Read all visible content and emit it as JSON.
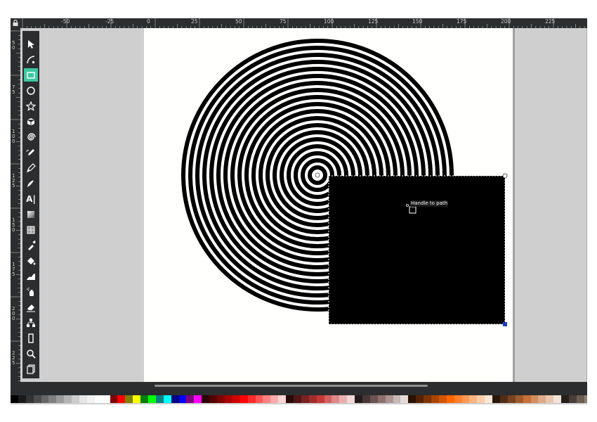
{
  "window": {
    "title": ""
  },
  "rulers": {
    "lock_icon": "lock-icon",
    "horizontal_labels": [
      "-50",
      "-25",
      "0",
      "25",
      "50",
      "75",
      "100",
      "125",
      "150",
      "175",
      "200",
      "225"
    ],
    "vertical_labels": [
      "50",
      "75",
      "100",
      "125",
      "150",
      "175",
      "200",
      "225"
    ]
  },
  "toolbox": {
    "tools": [
      {
        "name": "selector-tool",
        "icon": "arrow-icon",
        "active": false
      },
      {
        "name": "node-tool",
        "icon": "node-icon",
        "active": false
      },
      {
        "name": "rectangle-tool",
        "icon": "rectangle-icon",
        "active": true
      },
      {
        "name": "ellipse-tool",
        "icon": "circle-icon",
        "active": false
      },
      {
        "name": "star-tool",
        "icon": "star-icon",
        "active": false
      },
      {
        "name": "3d-box-tool",
        "icon": "cube-icon",
        "active": false
      },
      {
        "name": "spiral-tool",
        "icon": "spiral-icon",
        "active": false
      },
      {
        "name": "pencil-tool",
        "icon": "pencil-icon",
        "active": false
      },
      {
        "name": "pen-tool",
        "icon": "pen-icon",
        "active": false
      },
      {
        "name": "calligraphy-tool",
        "icon": "calligraphy-icon",
        "active": false
      },
      {
        "name": "text-tool",
        "icon": "text-icon",
        "active": false
      },
      {
        "name": "gradient-tool",
        "icon": "gradient-icon",
        "active": false
      },
      {
        "name": "mesh-tool",
        "icon": "mesh-icon",
        "active": false
      },
      {
        "name": "dropper-tool",
        "icon": "dropper-icon",
        "active": false
      },
      {
        "name": "paint-bucket-tool",
        "icon": "bucket-icon",
        "active": false
      },
      {
        "name": "tweak-tool",
        "icon": "tweak-icon",
        "active": false
      },
      {
        "name": "spray-tool",
        "icon": "spray-icon",
        "active": false
      },
      {
        "name": "eraser-tool",
        "icon": "eraser-icon",
        "active": false
      },
      {
        "name": "connector-tool",
        "icon": "connector-icon",
        "active": false
      },
      {
        "name": "measure-tool",
        "icon": "measure-icon",
        "active": false
      },
      {
        "name": "zoom-tool",
        "icon": "magnifier-icon",
        "active": false
      },
      {
        "name": "pages-tool",
        "icon": "pages-icon",
        "active": false
      }
    ],
    "text_tool_glyph": "A|"
  },
  "canvas": {
    "tooltip": "Handle to path",
    "spiral_color": "#000000",
    "rect_color": "#000000",
    "page_color": "#fffffd",
    "accent": "#3dc7a2"
  },
  "palette": {
    "swatches": [
      "#000000",
      "#1a1a1a",
      "#333333",
      "#4d4d4d",
      "#666666",
      "#808080",
      "#999999",
      "#b3b3b3",
      "#cccccc",
      "#e6e6e6",
      "#f2f2f2",
      "#ffffff",
      "#ffffff",
      "#800000",
      "#ff0000",
      "#808000",
      "#ffff00",
      "#008000",
      "#00ff00",
      "#008080",
      "#00ffff",
      "#000080",
      "#0000ff",
      "#800080",
      "#ff00ff",
      "#2b0000",
      "#550000",
      "#800000",
      "#aa0000",
      "#d40000",
      "#ff0000",
      "#ff2a2a",
      "#ff5555",
      "#ff8080",
      "#ffaaaa",
      "#ffd5d5",
      "#280b0b",
      "#501616",
      "#782121",
      "#a02c2c",
      "#c83737",
      "#d35f5f",
      "#de8787",
      "#e9afaf",
      "#f4d7d7",
      "#241c1c",
      "#483737",
      "#6c5353",
      "#916f6f",
      "#ac9393",
      "#c8b7b7",
      "#e3dbdb",
      "#2b1100",
      "#552200",
      "#803300",
      "#aa4400",
      "#d45500",
      "#ff6600",
      "#ff7f2a",
      "#ff9955",
      "#ffb380",
      "#ffccaa",
      "#ffe6d5",
      "#28170b",
      "#502d16",
      "#784421",
      "#a05a2c",
      "#c87137",
      "#d38d5f",
      "#deaa87",
      "#e9c6af",
      "#f4e3d7",
      "#241f1c",
      "#483e37",
      "#6c5d53",
      "#917c6f",
      "#ac9d93",
      "#c8beb7"
    ]
  }
}
